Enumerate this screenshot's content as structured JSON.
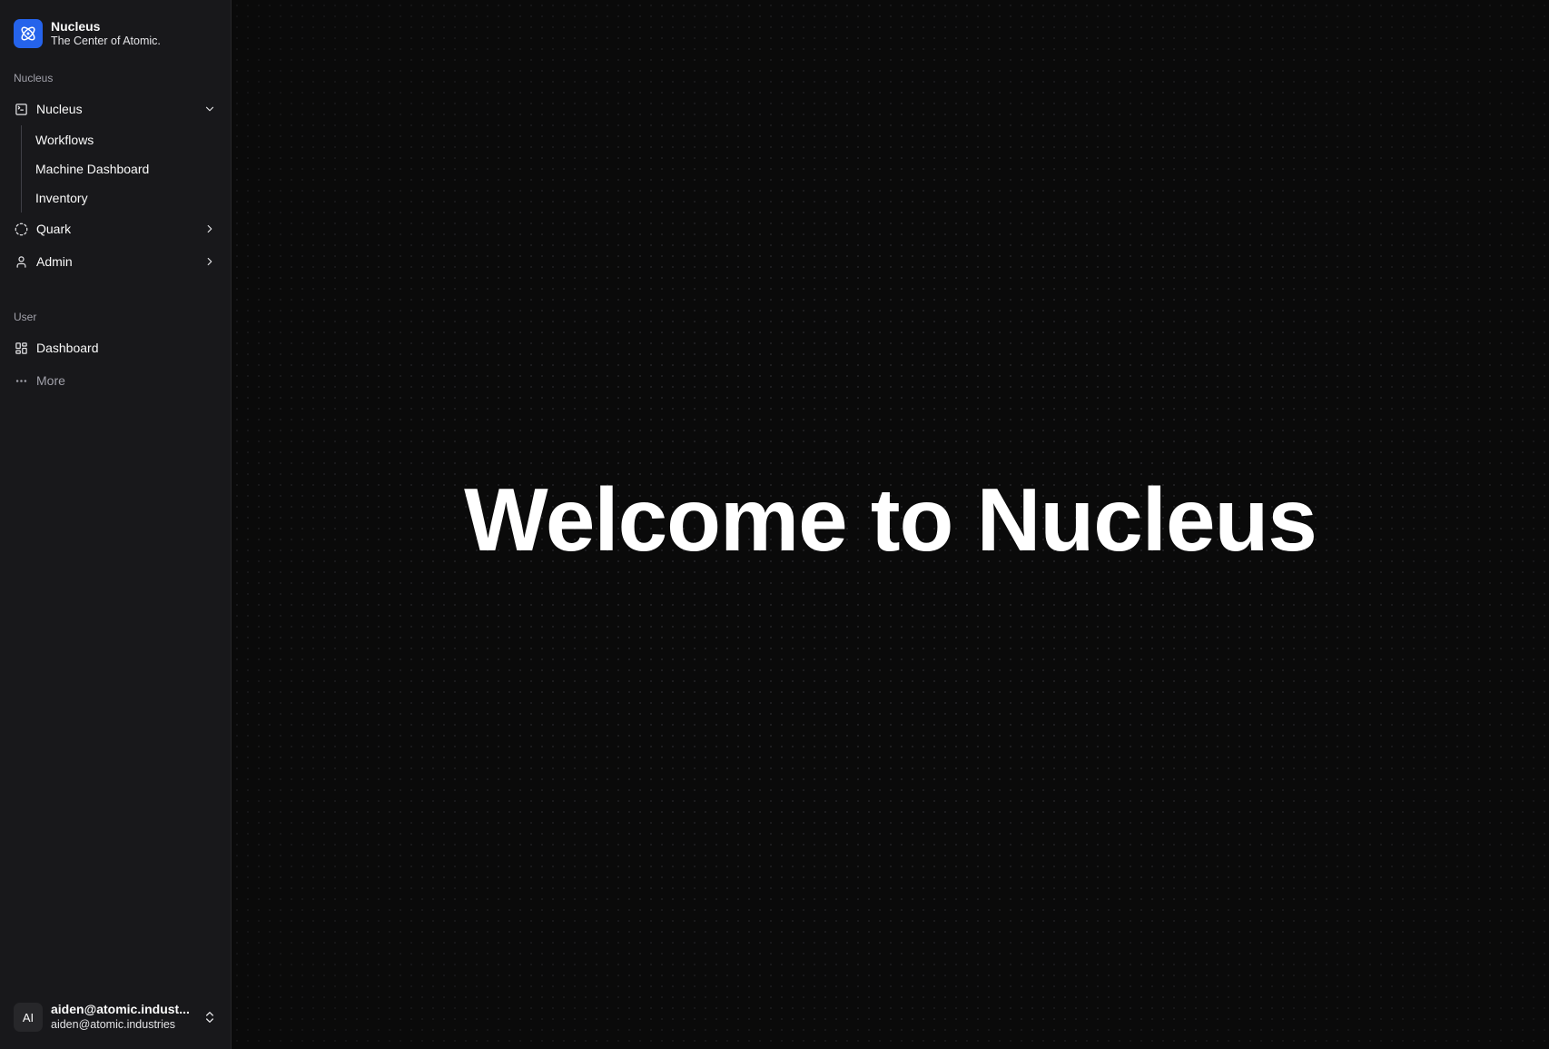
{
  "brand": {
    "name": "Nucleus",
    "tagline": "The Center of Atomic.",
    "color": "#2563eb"
  },
  "sidebar": {
    "groups": [
      {
        "label": "Nucleus",
        "items": [
          {
            "label": "Nucleus",
            "icon": "terminal-square-icon",
            "expanded": true,
            "children": [
              "Workflows",
              "Machine Dashboard",
              "Inventory"
            ]
          },
          {
            "label": "Quark",
            "icon": "circle-dashed-icon",
            "expanded": false
          },
          {
            "label": "Admin",
            "icon": "user-icon",
            "expanded": false
          }
        ]
      },
      {
        "label": "User",
        "items": [
          {
            "label": "Dashboard",
            "icon": "layout-dashboard-icon"
          },
          {
            "label": "More",
            "icon": "more-horizontal-icon"
          }
        ]
      }
    ]
  },
  "user": {
    "initials": "AI",
    "name": "aiden@atomic.indust...",
    "email": "aiden@atomic.industries"
  },
  "main": {
    "heading": "Welcome to Nucleus"
  }
}
